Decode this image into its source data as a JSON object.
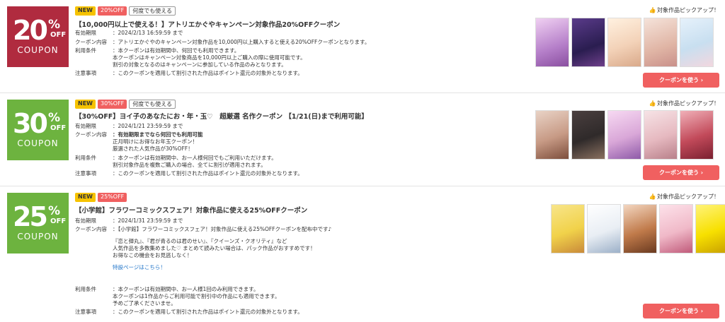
{
  "common": {
    "button_label": "クーポンを使う ›",
    "pickup_label": "対象作品ピックアップ！"
  },
  "coupons": [
    {
      "badge_pct": "20",
      "badge_sign": "%",
      "badge_off": "OFF",
      "badge_label": "COUPON",
      "badge_color": "#b02b3f",
      "tags": [
        "NEW",
        "20%OFF",
        "何度でも使える"
      ],
      "title": "【10,000円以上で使える！】アトリエかぐやキャンペーン対象作品20%OFFクーポン",
      "fields": [
        {
          "key": "有効期限",
          "lines": [
            "：2024/2/13 16:59:59 まで"
          ]
        },
        {
          "key": "クーポン内容",
          "lines": [
            "：アトリエかぐやのキャンペーン対象作品を10,000円以上購入すると使える20%OFFクーポンとなります。"
          ]
        },
        {
          "key": "利用条件",
          "lines": [
            "：本クーポンは有効期間中、何回でも利用できます。",
            "本クーポンはキャンペーン対象商品を10,000円以上ご購入の際に使用可能です。",
            "割引の対象となるのはキャンペーンに参加している作品のみとなります。"
          ]
        },
        {
          "key": "注意事項",
          "lines": [
            "：このクーポンを適用して割引された作品はポイント還元の対象外となります。"
          ]
        }
      ],
      "covers": [
        "#d8b0e0",
        "#3a2a6a",
        "#f3d9c6",
        "#e7c8b8",
        "#c8dff0"
      ]
    },
    {
      "badge_pct": "30",
      "badge_sign": "%",
      "badge_off": "OFF",
      "badge_label": "COUPON",
      "badge_color": "#6db33f",
      "tags": [
        "NEW",
        "30%OFF",
        "何度でも使える"
      ],
      "title": "【30%OFF】ヨイ子のあなたにお・年・玉♡　超厳選 名作クーポン 【1/21(日)まで利用可能】",
      "fields": [
        {
          "key": "有効期限",
          "lines": [
            "：2024/1/21 23:59:59 まで"
          ]
        },
        {
          "key": "クーポン内容",
          "lines": [
            "：有効期限までなら何回でも利用可能",
            "正月明けにお得なお年玉クーポン！",
            "厳選された人気作品が30%OFF！"
          ]
        },
        {
          "key": "利用条件",
          "lines": [
            "：本クーポンは有効期間中、お一人様何回でもご利用いただけます。",
            "割引対象作品を複数ご購入の場合、全てに割引が適用されます。"
          ]
        },
        {
          "key": "注意事項",
          "lines": [
            "：このクーポンを適用して割引された作品はポイント還元の対象外となります。"
          ]
        }
      ],
      "covers": [
        "#c79a85",
        "#2f2a2a",
        "#d9a7d8",
        "#e6b9c0",
        "#c24a5a"
      ]
    },
    {
      "badge_pct": "25",
      "badge_sign": "%",
      "badge_off": "OFF",
      "badge_label": "COUPON",
      "badge_color": "#6db33f",
      "tags": [
        "NEW",
        "25%OFF"
      ],
      "title": "【小学館】フラワーコミックスフェア！対象作品に使える25%OFFクーポン",
      "fields": [
        {
          "key": "有効期限",
          "lines": [
            "：2024/1/31 23:59:59 まで"
          ]
        },
        {
          "key": "クーポン内容",
          "lines": [
            "：【小学館】フラワーコミックスフェア！対象作品に使える25%OFFクーポンを配布中です♪",
            "",
            "『恋と弾丸』、『君が青るのは君のせい』、『クイーンズ・クオリティ』など",
            "人気作品を多数集めました♡ まとめて読みたい場合は、パック作品がおすすめです！",
            "お得なこの機会をお見逃しなく！",
            "",
            "特設ページはこちら！"
          ]
        },
        {
          "key": "利用条件",
          "lines": [
            "：本クーポンは有効期間中、お一人様1回のみ利用できます。",
            "本クーポンは1作品からご利用可能で割引中の作品にも適用できます。",
            "予めご了承くださいませ。"
          ]
        },
        {
          "key": "注意事項",
          "lines": [
            "：このクーポンを適用して割引された作品はポイント還元の対象外となります。"
          ]
        }
      ],
      "covers": [
        "#f1d24a",
        "#e9eef4",
        "#c07a4a",
        "#f0b9c8",
        "#f7e000"
      ]
    }
  ]
}
